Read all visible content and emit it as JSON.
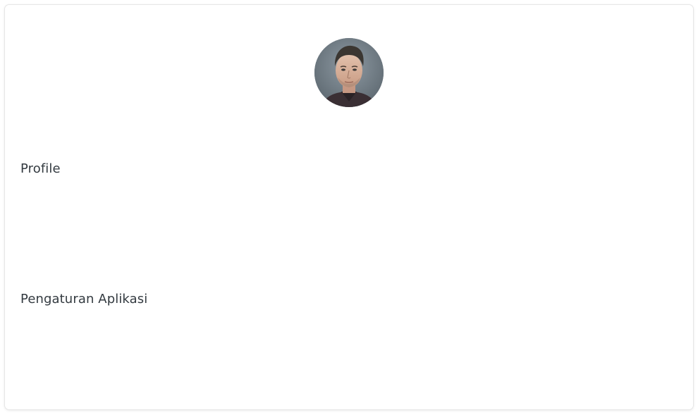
{
  "profile_card": {
    "avatar": {
      "alt": "user avatar"
    },
    "menu": [
      {
        "label": "Profile"
      },
      {
        "label": "Pengaturan Aplikasi"
      }
    ]
  }
}
